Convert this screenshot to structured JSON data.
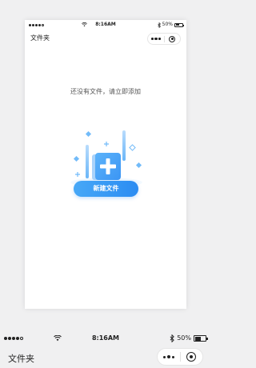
{
  "status_bar": {
    "time": "8:16AM",
    "battery": "50%",
    "battery_level": 0.5
  },
  "nav": {
    "title": "文件夹"
  },
  "empty_state": {
    "message": "还没有文件，请立即添加",
    "button_label": "新建文件"
  },
  "colors": {
    "accent": "#2b8cf2",
    "accent_light": "#47a8f7",
    "background": "#f0f0f1"
  },
  "icons": {
    "signal": "signal-dots-icon",
    "wifi": "wifi-icon",
    "bluetooth": "bluetooth-icon",
    "battery": "battery-icon",
    "more": "more-icon",
    "close": "close-circle-icon",
    "illustration": "add-file-illustration"
  }
}
